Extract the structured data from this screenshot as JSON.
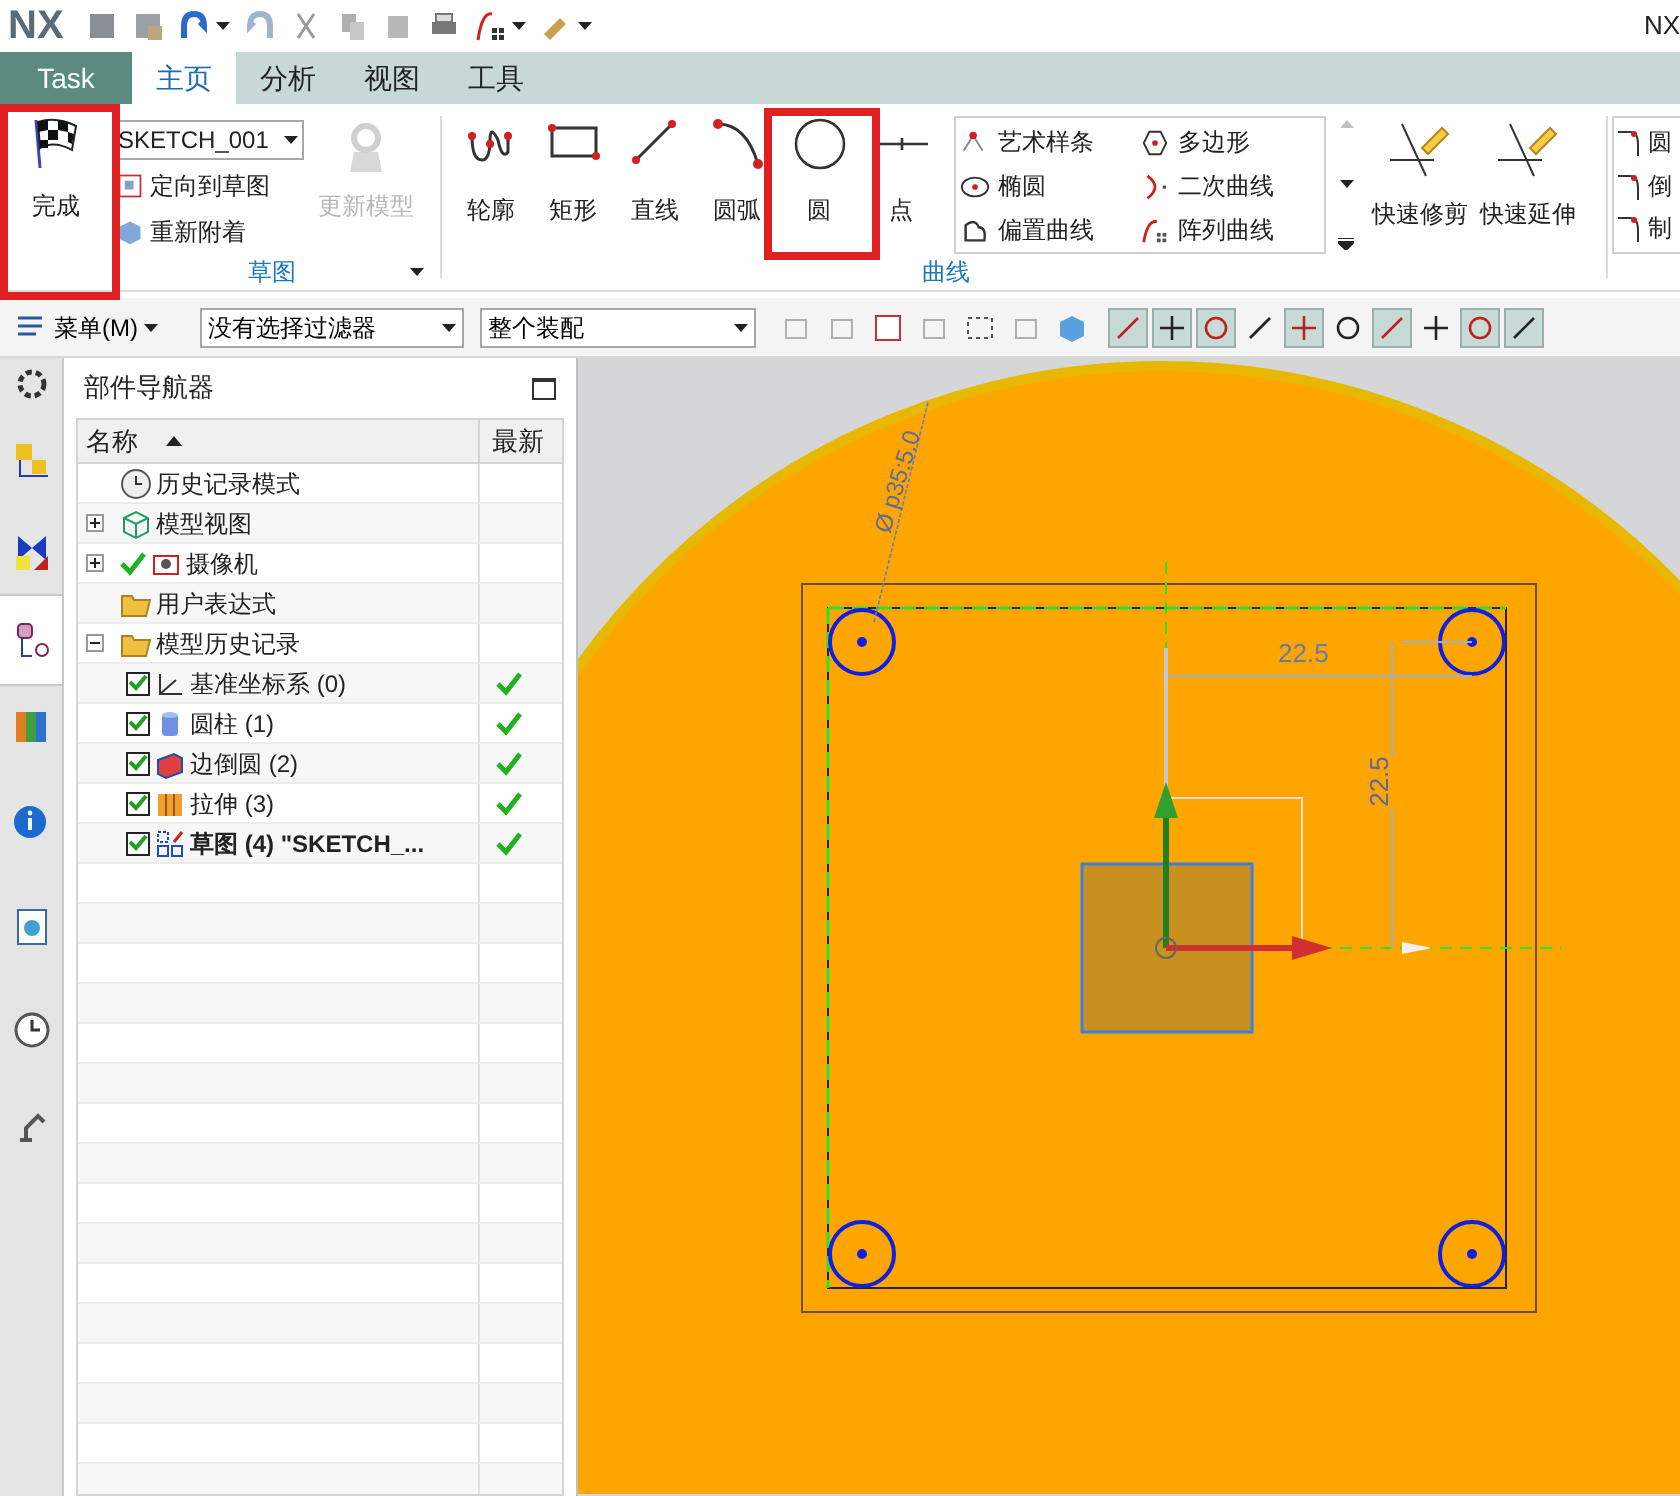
{
  "app": {
    "logo": "NX",
    "logo_right": "NX"
  },
  "tabs": [
    {
      "label": "Task",
      "kind": "task",
      "selected": false
    },
    {
      "label": "主页",
      "kind": "tab",
      "selected": true
    },
    {
      "label": "分析",
      "kind": "tab",
      "selected": false
    },
    {
      "label": "视图",
      "kind": "tab",
      "selected": false
    },
    {
      "label": "工具",
      "kind": "tab",
      "selected": false
    }
  ],
  "ribbon": {
    "finish": "完成",
    "sketch_group": {
      "sketch_name": "SKETCH_001",
      "commands": [
        "定向到草图",
        "重新附着"
      ],
      "update_model": {
        "label": "更新模型",
        "disabled": true
      },
      "label": "草图"
    },
    "curve_group": {
      "big_commands": [
        "轮廓",
        "矩形",
        "直线",
        "圆弧",
        "圆",
        "点"
      ],
      "gallery": [
        "艺术样条",
        "多边形",
        "椭圆",
        "二次曲线",
        "偏置曲线",
        "阵列曲线"
      ],
      "edit_commands": [
        "快速修剪",
        "快速延伸"
      ],
      "label": "曲线"
    },
    "cut_commands": [
      "圆",
      "倒",
      "制"
    ]
  },
  "toolbar": {
    "menu": "菜单(M)",
    "filter": "没有选择过滤器",
    "scope": "整个装配",
    "snap_buttons": [
      {
        "on": true
      },
      {
        "on": true
      },
      {
        "on": true
      },
      {
        "on": false
      },
      {
        "on": true
      },
      {
        "on": false
      },
      {
        "on": true
      },
      {
        "on": false
      },
      {
        "on": true
      },
      {
        "on": true
      }
    ]
  },
  "resource_tabs": [
    {
      "selected": false
    },
    {
      "selected": false
    },
    {
      "selected": false
    },
    {
      "selected": true
    },
    {
      "selected": false
    },
    {
      "selected": false
    },
    {
      "selected": false
    },
    {
      "selected": false
    },
    {
      "selected": false
    }
  ],
  "navigator": {
    "title": "部件导航器",
    "columns": [
      "名称",
      "最新"
    ],
    "tree": [
      {
        "label": "历史记录模式"
      },
      {
        "label": "模型视图",
        "expanded": false
      },
      {
        "label": "摄像机",
        "expanded": false,
        "checked": true
      },
      {
        "label": "用户表达式"
      },
      {
        "label": "模型历史记录",
        "expanded": true,
        "children": [
          {
            "label": "基准坐标系 (0)",
            "checked": true,
            "latest": true,
            "current": false
          },
          {
            "label": "圆柱 (1)",
            "checked": true,
            "latest": true,
            "current": false
          },
          {
            "label": "边倒圆 (2)",
            "checked": true,
            "latest": true,
            "current": false
          },
          {
            "label": "拉伸 (3)",
            "checked": true,
            "latest": true,
            "current": false
          },
          {
            "label": "草图 (4) \"SKETCH_...",
            "checked": true,
            "latest": true,
            "current": true
          }
        ]
      }
    ]
  },
  "viewport": {
    "diameter_dimension": "Ø p35:5.0",
    "horizontal_dimension": "22.5",
    "vertical_dimension": "22.5"
  }
}
